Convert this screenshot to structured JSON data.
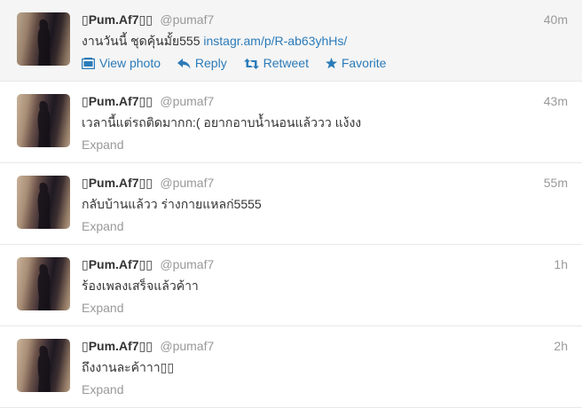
{
  "tweets": [
    {
      "fullname": "▯Pum.Af7▯▯",
      "username": "@pumaf7",
      "time": "40m",
      "text": "งานวันนี้ ชุดคุ้นมั้ย555 ",
      "link": "instagr.am/p/R-ab63yhHs/",
      "actions": {
        "view_photo": "View photo",
        "reply": "Reply",
        "retweet": "Retweet",
        "favorite": "Favorite"
      }
    },
    {
      "fullname": "▯Pum.Af7▯▯",
      "username": "@pumaf7",
      "time": "43m",
      "text": "เวลานี้แต่รถติดมากก:( อยากอาบน้ำนอนแล้ววว แง้งง",
      "expand": "Expand"
    },
    {
      "fullname": "▯Pum.Af7▯▯",
      "username": "@pumaf7",
      "time": "55m",
      "text": "กลับบ้านแล้วว ร่างกายแหลก่5555",
      "expand": "Expand"
    },
    {
      "fullname": "▯Pum.Af7▯▯",
      "username": "@pumaf7",
      "time": "1h",
      "text": "ร้องเพลงเสร็จแล้วค้าา",
      "expand": "Expand"
    },
    {
      "fullname": "▯Pum.Af7▯▯",
      "username": "@pumaf7",
      "time": "2h",
      "text": "ถึงงานละค้าาา▯▯",
      "expand": "Expand"
    }
  ],
  "colors": {
    "link": "#2b7bb9",
    "meta": "#999999",
    "text": "#333333",
    "hover_background": "#f5f5f5",
    "divider": "#e8e8e8"
  },
  "icons": {
    "view_photo": "photo-icon",
    "reply": "reply-icon",
    "retweet": "retweet-icon",
    "favorite": "star-icon"
  }
}
